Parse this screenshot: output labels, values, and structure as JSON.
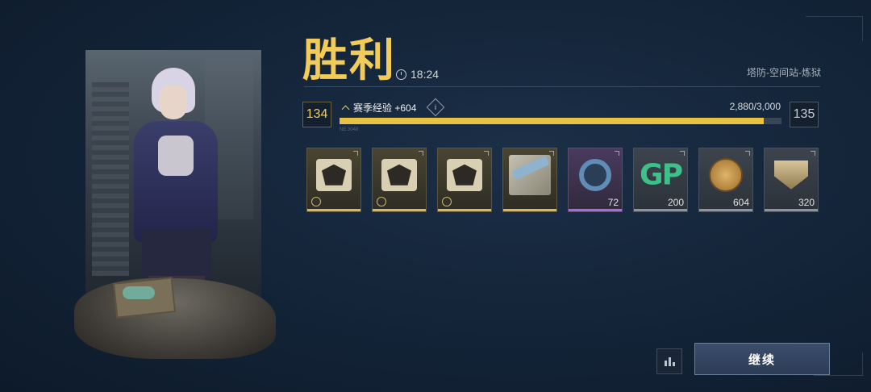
{
  "result": {
    "title": "胜利",
    "time": "18:24",
    "mode": "塔防-空间站-炼狱"
  },
  "progress": {
    "current_level": "134",
    "next_level": "135",
    "xp_label": "赛季经验 +604",
    "info_label": "i",
    "xp_count": "2,880/3,000",
    "xp_fraction": 0.96,
    "small_code": "NE.3048"
  },
  "rewards": [
    {
      "icon": "emblem-card-icon",
      "rarity": "gold",
      "qty": ""
    },
    {
      "icon": "emblem-card-icon",
      "rarity": "gold",
      "qty": ""
    },
    {
      "icon": "emblem-card-icon",
      "rarity": "gold",
      "qty": ""
    },
    {
      "icon": "weapon-skin-icon",
      "rarity": "gold",
      "qty": ""
    },
    {
      "icon": "ring-token-icon",
      "rarity": "purple",
      "qty": "72"
    },
    {
      "icon": "gp-currency-icon",
      "rarity": "grey",
      "qty": "200"
    },
    {
      "icon": "coin-currency-icon",
      "rarity": "grey",
      "qty": "604"
    },
    {
      "icon": "shield-token-icon",
      "rarity": "grey",
      "qty": "320"
    }
  ],
  "gp_text": "GP",
  "buttons": {
    "continue": "继续"
  },
  "colors": {
    "accent_gold": "#f2cb58",
    "xp_fill": "#e8c343",
    "background": "#132337"
  }
}
